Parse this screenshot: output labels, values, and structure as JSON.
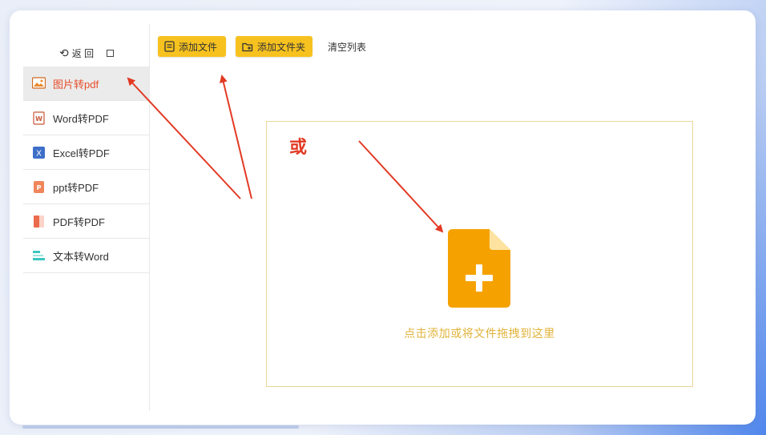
{
  "sidebar": {
    "back_label": "返 回",
    "items": [
      {
        "label": "图片转pdf",
        "icon": "image-icon",
        "active": true
      },
      {
        "label": "Word转PDF",
        "icon": "word-icon",
        "active": false
      },
      {
        "label": "Excel转PDF",
        "icon": "excel-icon",
        "active": false
      },
      {
        "label": "ppt转PDF",
        "icon": "ppt-icon",
        "active": false
      },
      {
        "label": "PDF转PDF",
        "icon": "pdf-icon",
        "active": false
      },
      {
        "label": "文本转Word",
        "icon": "text-icon",
        "active": false
      }
    ]
  },
  "toolbar": {
    "add_file_label": "添加文件",
    "add_folder_label": "添加文件夹",
    "clear_label": "清空列表"
  },
  "dropzone": {
    "or_text": "或",
    "hint": "点击添加或将文件拖拽到这里"
  },
  "colors": {
    "accent_yellow": "#f7c21f",
    "icon_orange": "#f5a200",
    "active_text": "#e84c2b",
    "annotation_red": "#e23a24",
    "hint_text": "#e0b33a"
  }
}
